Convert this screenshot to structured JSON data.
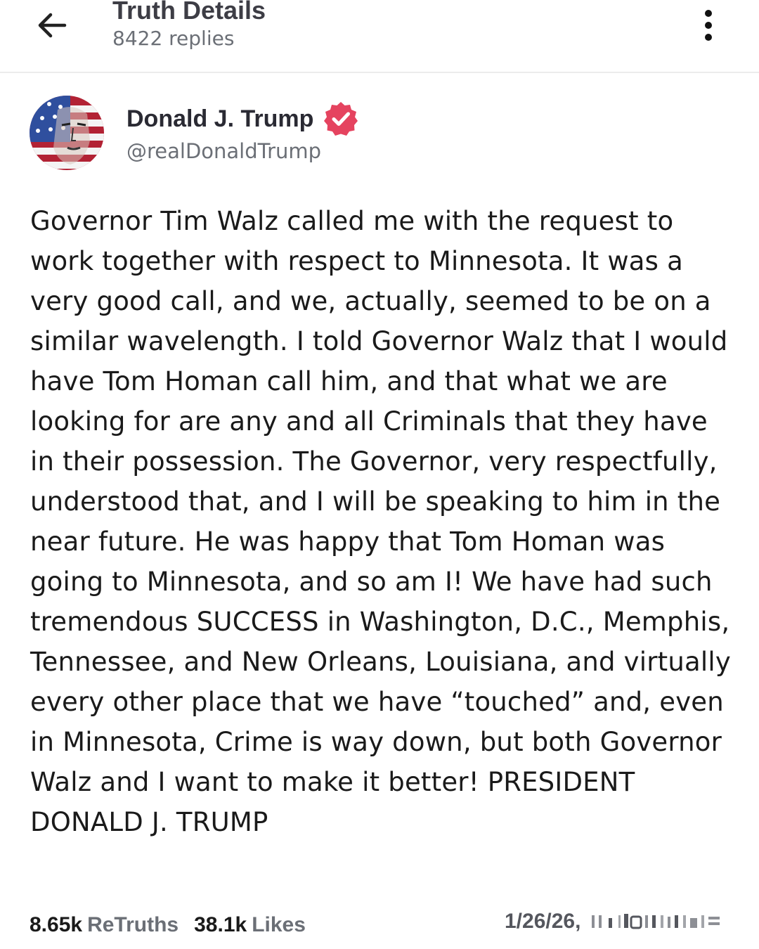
{
  "header": {
    "title": "Truth Details",
    "subtitle": "8422 replies",
    "back_icon": "arrow-left-icon",
    "more_icon": "more-vertical-icon"
  },
  "author": {
    "name": "Donald J. Trump",
    "handle": "@realDonaldTrump",
    "verified_color": "#e5435f"
  },
  "post": {
    "text": "Governor Tim Walz called me with the request to work together with respect to Minnesota. It was a very good call, and we, actually, seemed to be on a similar wavelength. I told Governor Walz that I would have Tom Homan call him, and that what we are looking for are any and all Criminals that they have in their possession. The Governor, very respectfully, understood that, and I will be speaking to him in the near future. He was happy that Tom Homan was going to Minnesota, and so am I! We have had such tremendous SUCCESS in Washington, D.C., Memphis, Tennessee, and New Orleans, Louisiana, and virtually every other place that we have “touched” and, even in Minnesota, Crime is way down, but both Governor Walz and I want to make it better! PRESIDENT DONALD J. TRUMP"
  },
  "stats": {
    "retruths_count": "8.65k",
    "retruths_label": "ReTruths",
    "likes_count": "38.1k",
    "likes_label": "Likes",
    "date": "1/26/26,"
  }
}
